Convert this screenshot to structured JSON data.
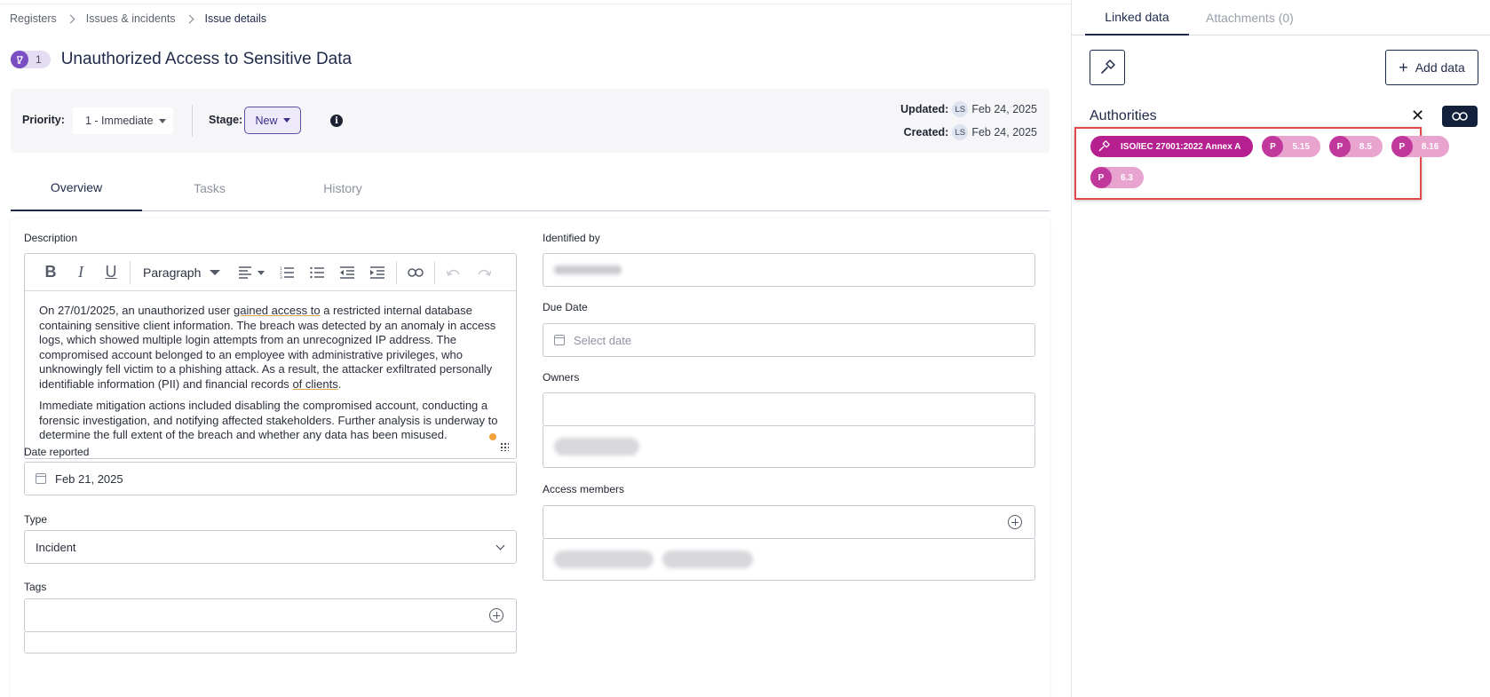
{
  "breadcrumb": {
    "items": [
      "Registers",
      "Issues & incidents",
      "Issue details"
    ]
  },
  "issue": {
    "count": "1",
    "title": "Unauthorized Access to Sensitive Data"
  },
  "meta": {
    "priority_label": "Priority:",
    "priority_value": "1 - Immediate",
    "stage_label": "Stage:",
    "stage_value": "New",
    "updated_label": "Updated:",
    "updated_initials": "LS",
    "updated_date": "Feb 24, 2025",
    "created_label": "Created:",
    "created_initials": "LS",
    "created_date": "Feb 24, 2025"
  },
  "tabs": [
    {
      "label": "Overview",
      "active": true
    },
    {
      "label": "Tasks",
      "active": false
    },
    {
      "label": "History",
      "active": false
    }
  ],
  "description": {
    "label": "Description",
    "toolbar": {
      "paragraph": "Paragraph"
    },
    "p1_a": "On 27/01/2025, an unauthorized user ",
    "p1_u1": "gained access to",
    "p1_b": " a restricted internal database containing sensitive client information. The breach was detected by an anomaly in access logs, which showed multiple login attempts from an unrecognized IP address. The compromised account belonged to an employee with administrative privileges, who unknowingly fell victim to a phishing attack. As a result, the attacker exfiltrated personally identifiable information (PII) and financial records ",
    "p1_u2": "of clients",
    "p1_c": ".",
    "p2": "Immediate mitigation actions included disabling the compromised account, conducting a forensic investigation, and notifying affected stakeholders. Further analysis is underway to determine the full extent of the breach and whether any data has been misused."
  },
  "fields": {
    "date_reported_label": "Date reported",
    "date_reported_value": "Feb 21, 2025",
    "type_label": "Type",
    "type_value": "Incident",
    "tags_label": "Tags",
    "identified_by_label": "Identified by",
    "due_date_label": "Due Date",
    "due_date_placeholder": "Select date",
    "owners_label": "Owners",
    "access_members_label": "Access members"
  },
  "sidebar": {
    "tabs": [
      {
        "label": "Linked data",
        "active": true
      },
      {
        "label": "Attachments (0)",
        "active": false
      }
    ],
    "add_data_label": "Add data",
    "authorities_title": "Authorities",
    "close_symbol": "✕",
    "authority_chip": "ISO/IEC 27001:2022 Annex A",
    "p_letter": "P",
    "controls": [
      "5.15",
      "8.5",
      "8.16",
      "6.3"
    ]
  },
  "colors": {
    "accent_navy": "#1f2a4a",
    "authority_magenta": "#b51f8f",
    "control_pink": "#e8a4cf",
    "highlight_red": "#e24a4a",
    "stage_purple": "#5b4fa8"
  },
  "icons": [
    "chevron-right-icon",
    "issue-type-icon",
    "caret-down-icon",
    "info-icon",
    "calendar-icon",
    "chevron-down-icon",
    "plus-circle-icon",
    "hammer-icon",
    "plus-icon",
    "close-icon",
    "link-icon"
  ]
}
